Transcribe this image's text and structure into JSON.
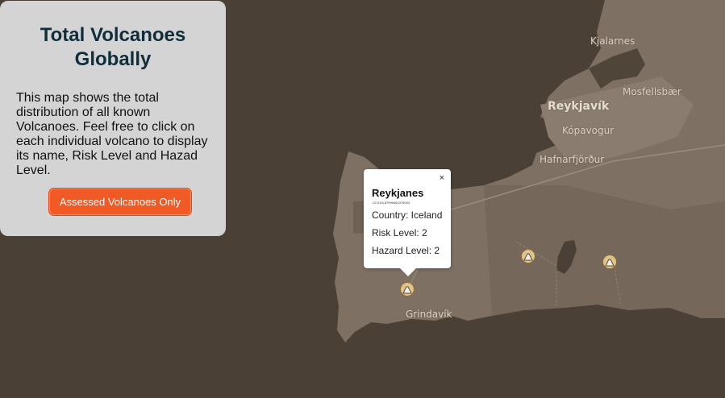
{
  "panel": {
    "title": "Total Volcanoes Globally",
    "description": "This map shows the total distribution of all known Volcanoes. Feel free to click on each individual volcano to display its name, Risk Level and Hazad Level.",
    "button_label": "Assessed Volcanoes Only",
    "button_color": "#f15a24"
  },
  "map": {
    "labels": [
      "Kjalarnes",
      "Mosfellsbær",
      "Reykjavík",
      "Kópavogur",
      "Hafnarfjörður",
      "Grindavík"
    ],
    "marker_icon": "volcano-icon",
    "marker_count": 3
  },
  "popup": {
    "close_label": "×",
    "name": "Reykjanes",
    "coords": "-22.5,63.87999461075093",
    "country": "Country: Iceland",
    "risk": "Risk Level: 2",
    "hazard": "Hazard Level: 2"
  }
}
